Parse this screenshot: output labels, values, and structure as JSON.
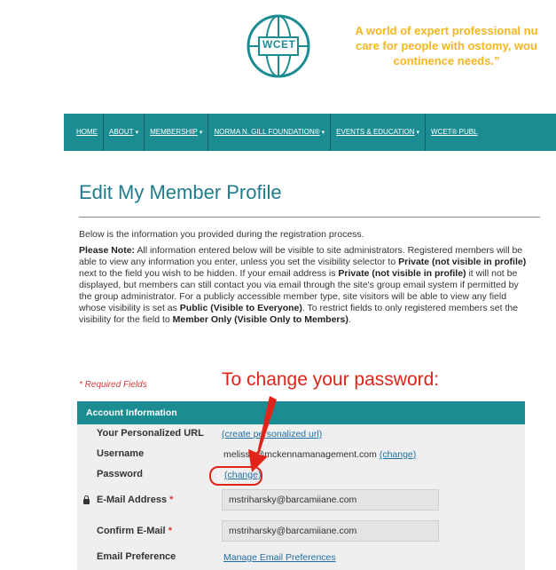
{
  "logo": {
    "text": "WCET"
  },
  "tagline": {
    "line1": "A world of expert professional nu",
    "line2": "care for people with ostomy, wou",
    "line3": "continence needs.”"
  },
  "nav": [
    {
      "label": "HOME",
      "caret": ""
    },
    {
      "label": "ABOUT",
      "caret": "▾"
    },
    {
      "label": "MEMBERSHIP",
      "caret": "▾"
    },
    {
      "label": "NORMA N. GILL FOUNDATION®",
      "caret": "▾"
    },
    {
      "label": "EVENTS & EDUCATION",
      "caret": "▾"
    },
    {
      "label": "WCET® PUBL",
      "caret": ""
    }
  ],
  "page": {
    "title": "Edit My Member Profile",
    "intro": "Below is the information you provided during the registration process.",
    "note_parts": [
      {
        "t": "Please Note:",
        "b": true
      },
      {
        "t": " All information entered below will be visible to site administrators. Registered members will be able to view any information you enter, unless you set the visibility selector to ",
        "b": false
      },
      {
        "t": "Private (not visible in profile)",
        "b": true
      },
      {
        "t": " next to the field you wish to be hidden. If your email address is ",
        "b": false
      },
      {
        "t": "Private (not visible in profile)",
        "b": true
      },
      {
        "t": " it will not be displayed, but members can still contact you via email through the site's group email system if permitted by the group administrator. For a publicly accessible member type, site visitors will be able to view any field whose visibility is set as ",
        "b": false
      },
      {
        "t": "Public (Visible to Everyone)",
        "b": true
      },
      {
        "t": ". To restrict fields to only registered members set the visibility for the field to ",
        "b": false
      },
      {
        "t": "Member Only (Visible Only to Members)",
        "b": true
      },
      {
        "t": ".",
        "b": false
      }
    ],
    "required_fields": "* Required Fields",
    "callout": "To change your password:"
  },
  "account": {
    "header": "Account Information",
    "personalized_url_label": "Your Personalized URL",
    "personalized_url_link": "(create personalized url)",
    "username_label": "Username",
    "username_value": "melissa@mckennamanagement.com",
    "username_change": "(change)",
    "password_label": "Password",
    "password_change": "(change)",
    "email_label": "E-Mail Address",
    "email_value": "mstriharsky@barcamiiane.com",
    "confirm_label": "Confirm E-Mail",
    "confirm_value": "mstriharsky@barcamiiane.com",
    "pref_label": "Email Preference",
    "pref_link": "Manage Email Preferences",
    "required_star": "*"
  },
  "colors": {
    "teal": "#1b8c92",
    "title": "#1f7c8c",
    "tagline": "#f5b61e",
    "annotation_red": "#e2231a"
  }
}
